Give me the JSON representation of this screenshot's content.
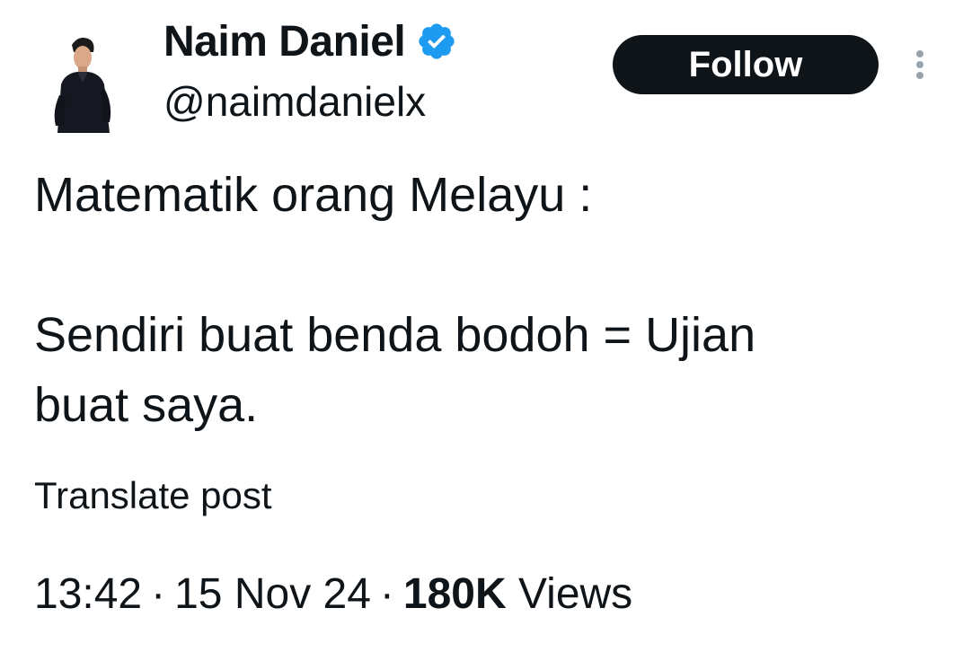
{
  "author": {
    "display_name": "Naim Daniel",
    "handle": "@naimdanielx",
    "verified": true,
    "verified_color": "#1d9bf0"
  },
  "actions": {
    "follow_label": "Follow",
    "more_icon": "more-vertical-icon"
  },
  "tweet": {
    "lines": [
      "Matematik orang Melayu :",
      "",
      "Sendiri buat benda bodoh = Ujian",
      "buat saya."
    ],
    "translate_label": "Translate post"
  },
  "meta": {
    "time": "13:42",
    "date": "15 Nov 24",
    "separator": "·",
    "views_count": "180K",
    "views_label": "Views"
  }
}
